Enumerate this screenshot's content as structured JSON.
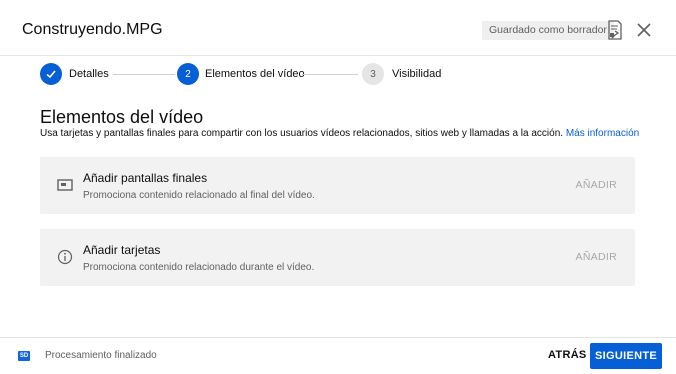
{
  "header": {
    "title": "Construyendo.MPG",
    "draft_badge": "Guardado como borrador",
    "feedback_icon": "feedback-icon",
    "close_icon": "close-icon"
  },
  "stepper": {
    "steps": [
      {
        "number": "",
        "label": "Detalles",
        "state": "completed"
      },
      {
        "number": "2",
        "label": "Elementos del vídeo",
        "state": "active"
      },
      {
        "number": "3",
        "label": "Visibilidad",
        "state": "pending"
      }
    ],
    "colors": {
      "completed": "#065fd4",
      "active": "#065fd4",
      "pending": "#e5e5e5"
    }
  },
  "main": {
    "title": "Elementos del vídeo",
    "description": "Usa tarjetas y pantallas finales para compartir con los usuarios vídeos relacionados, sitios web y llamadas a la acción.",
    "more_info_link": "Más información",
    "cards": [
      {
        "icon": "end-screen-icon",
        "title": "Añadir pantallas finales",
        "subtitle": "Promociona contenido relacionado al final del vídeo.",
        "action": "AÑADIR"
      },
      {
        "icon": "info-icon",
        "title": "Añadir tarjetas",
        "subtitle": "Promociona contenido relacionado durante el vídeo.",
        "action": "AÑADIR"
      }
    ]
  },
  "footer": {
    "sd_badge": "SD",
    "status": "Procesamiento finalizado",
    "back_label": "ATRÁS",
    "next_label": "SIGUIENTE"
  },
  "colors": {
    "accent": "#065fd4",
    "card_bg": "#f2f2f2",
    "muted_text": "#606060"
  }
}
